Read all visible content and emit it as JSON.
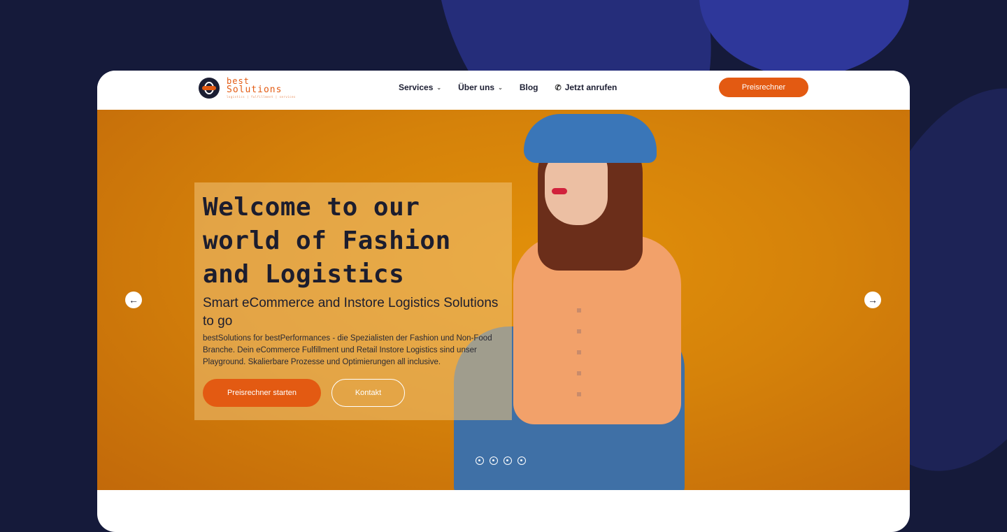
{
  "logo": {
    "line1": "best",
    "line2": "Solutions",
    "tagline": "logistics | fulfillment | services"
  },
  "nav": {
    "services": "Services",
    "about": "Über uns",
    "blog": "Blog",
    "call": "Jetzt anrufen",
    "cta": "Preisrechner"
  },
  "hero": {
    "title": "Welcome to our world of Fashion and Logistics",
    "subtitle": "Smart eCommerce and Instore Logistics Solutions to go",
    "description": "bestSolutions for bestPerformances - die Spezialisten der Fashion und Non-Food Branche. Dein eCommerce Fulfillment und Retail Instore Logistics sind unser Playground. Skalierbare Prozesse und Optimierungen all inclusive.",
    "primary_button": "Preisrechner starten",
    "secondary_button": "Kontakt"
  },
  "slider": {
    "slide_count": 4,
    "prev_icon": "arrow-left",
    "next_icon": "arrow-right"
  },
  "colors": {
    "accent": "#e35a12",
    "background": "#151a3a",
    "hero": "#d5820a"
  }
}
